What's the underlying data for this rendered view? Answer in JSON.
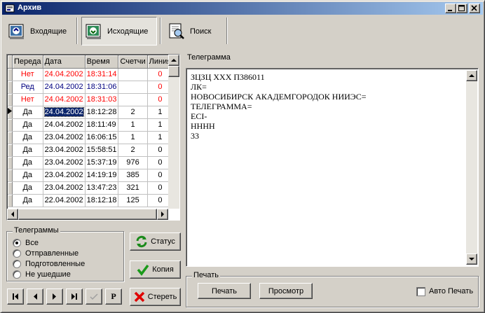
{
  "window": {
    "title": "Архив"
  },
  "tabs": [
    {
      "label": "Входящие",
      "icon": "inbox-icon"
    },
    {
      "label": "Исходящие",
      "icon": "outbox-icon"
    },
    {
      "label": "Поиск",
      "icon": "search-icon"
    }
  ],
  "grid": {
    "columns": [
      "Переда",
      "Дата",
      "Время",
      "Счетчи",
      "Линия"
    ],
    "rows": [
      {
        "status": "Нет",
        "date": "24.04.2002",
        "time": "18:31:14",
        "counter": "",
        "line": "0",
        "color": "#ff0000"
      },
      {
        "status": "Ред",
        "date": "24.04.2002",
        "time": "18:31:06",
        "counter": "",
        "line": "0",
        "color": "#000080"
      },
      {
        "status": "Нет",
        "date": "24.04.2002",
        "time": "18:31:03",
        "counter": "",
        "line": "0",
        "color": "#ff0000"
      },
      {
        "status": "Да",
        "date": "24.04.2002",
        "time": "18:12:28",
        "counter": "2",
        "line": "1",
        "color": "#000000"
      },
      {
        "status": "Да",
        "date": "24.04.2002",
        "time": "18:11:49",
        "counter": "1",
        "line": "1",
        "color": "#000000"
      },
      {
        "status": "Да",
        "date": "23.04.2002",
        "time": "16:06:15",
        "counter": "1",
        "line": "1",
        "color": "#000000"
      },
      {
        "status": "Да",
        "date": "23.04.2002",
        "time": "15:58:51",
        "counter": "2",
        "line": "0",
        "color": "#000000"
      },
      {
        "status": "Да",
        "date": "23.04.2002",
        "time": "15:37:19",
        "counter": "976",
        "line": "0",
        "color": "#000000"
      },
      {
        "status": "Да",
        "date": "23.04.2002",
        "time": "14:19:19",
        "counter": "385",
        "line": "0",
        "color": "#000000"
      },
      {
        "status": "Да",
        "date": "23.04.2002",
        "time": "13:47:23",
        "counter": "321",
        "line": "0",
        "color": "#000000"
      },
      {
        "status": "Да",
        "date": "22.04.2002",
        "time": "18:12:18",
        "counter": "125",
        "line": "0",
        "color": "#000000"
      }
    ],
    "selected_row": 3
  },
  "filter": {
    "legend": "Телеграммы",
    "options": [
      "Все",
      "Отправленные",
      "Подготовленные",
      "Не ушедшие"
    ],
    "selected": 0
  },
  "buttons": {
    "status": "Статус",
    "copy": "Копия",
    "delete": "Стереть"
  },
  "nav": {
    "p_label": "P"
  },
  "telegram": {
    "label": "Телеграмма",
    "text": "ЗЦЗЦ ХХХ П386011\nЛК=\nНОВОСИБИРСК АКАДЕМГОРОДОК НИИЭС=\nТЕЛЕГРАММА=\nЕСI-\nНННН\n33"
  },
  "print": {
    "legend": "Печать",
    "print_label": "Печать",
    "preview_label": "Просмотр",
    "auto_label": "Авто Печать"
  }
}
